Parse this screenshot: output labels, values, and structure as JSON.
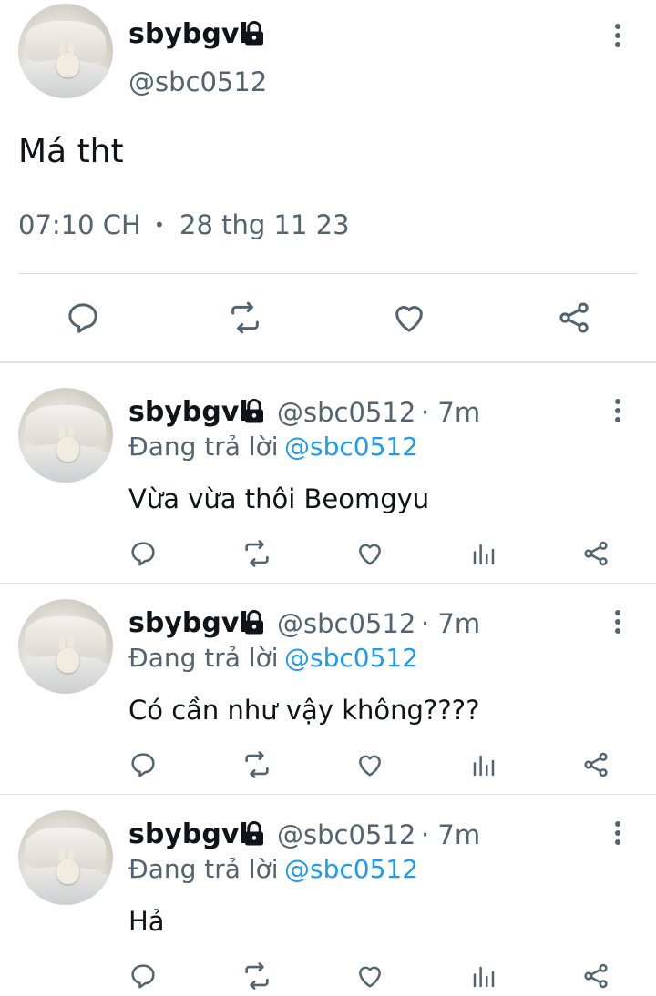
{
  "main_tweet": {
    "display_name": "sbybgvl",
    "handle": "@sbc0512",
    "text": "Má tht",
    "time": "07:10 CH",
    "separator": "•",
    "date": "28 thg 11 23"
  },
  "replies": [
    {
      "display_name": "sbybgvl",
      "handle": "@sbc0512",
      "age": "· 7m",
      "replying_prefix": "Đang trả lời",
      "replying_to": "@sbc0512",
      "text": "Vừa vừa thôi Beomgyu"
    },
    {
      "display_name": "sbybgvl",
      "handle": "@sbc0512",
      "age": "· 7m",
      "replying_prefix": "Đang trả lời",
      "replying_to": "@sbc0512",
      "text": "Có cần như vậy không????"
    },
    {
      "display_name": "sbybgvl",
      "handle": "@sbc0512",
      "age": "· 7m",
      "replying_prefix": "Đang trả lời",
      "replying_to": "@sbc0512",
      "text": "Hả"
    }
  ],
  "icons": {
    "reply": "reply-icon",
    "retweet": "retweet-icon",
    "like": "like-icon",
    "views": "views-icon",
    "share": "share-icon",
    "lock": "lock-icon",
    "more": "more-icon"
  },
  "colors": {
    "text": "#0f1419",
    "muted": "#536471",
    "link": "#1d9bf0",
    "divider": "#dde1e4"
  }
}
